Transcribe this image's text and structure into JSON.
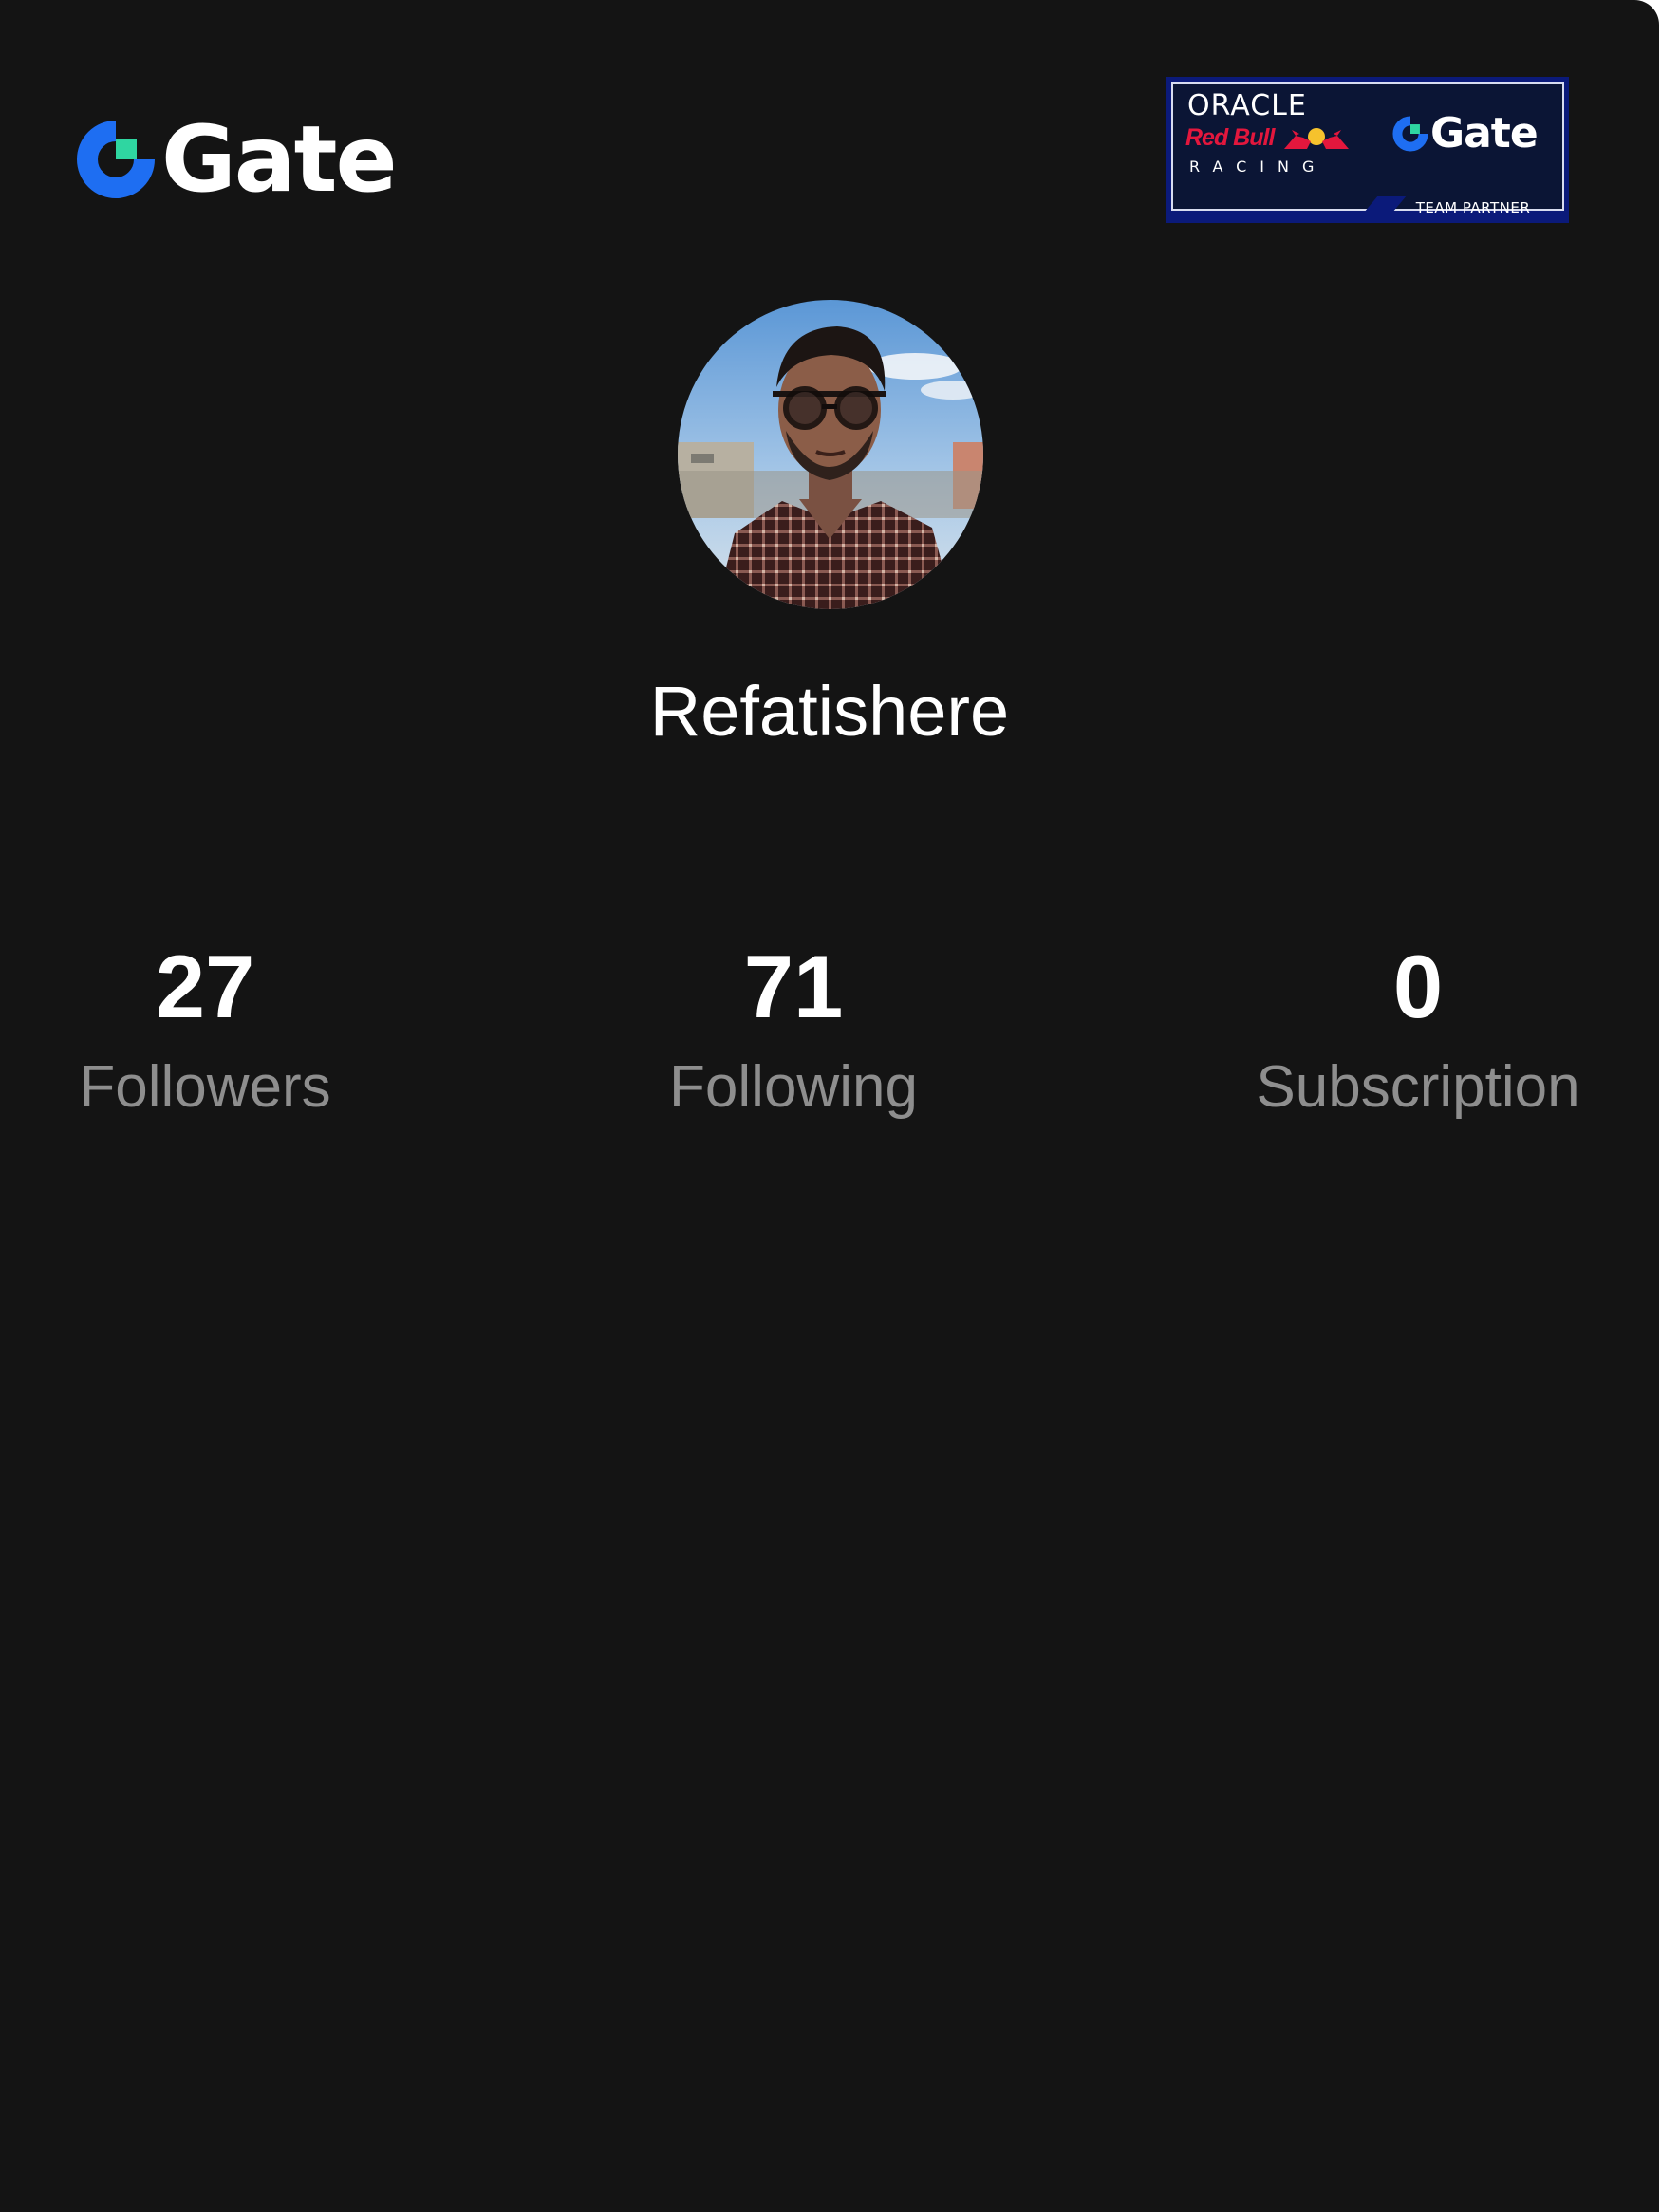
{
  "header": {
    "brand_logo": {
      "name": "Gate",
      "icon": "gate-logo-mark",
      "colors": {
        "ring": "#1e6ef2",
        "square": "#2fd6a1"
      }
    },
    "partner_badge": {
      "line1": "ORACLE",
      "line2": "Red Bull",
      "line3": "RACING",
      "brand": "Gate",
      "caption": "TEAM PARTNER",
      "icon": "red-bull-emblem",
      "colors": {
        "frame": "#0b1a7a",
        "panel": "#0b1535",
        "red": "#e3173d",
        "yellow": "#f6c22d"
      }
    }
  },
  "profile": {
    "avatar": "profile-photo",
    "username": "Refatishere"
  },
  "stats": [
    {
      "value": "27",
      "label": "Followers"
    },
    {
      "value": "71",
      "label": "Following"
    },
    {
      "value": "0",
      "label": "Subscription"
    }
  ],
  "theme": {
    "background": "#141414",
    "primary_text": "#ffffff",
    "secondary_text": "#8e8e8e"
  }
}
